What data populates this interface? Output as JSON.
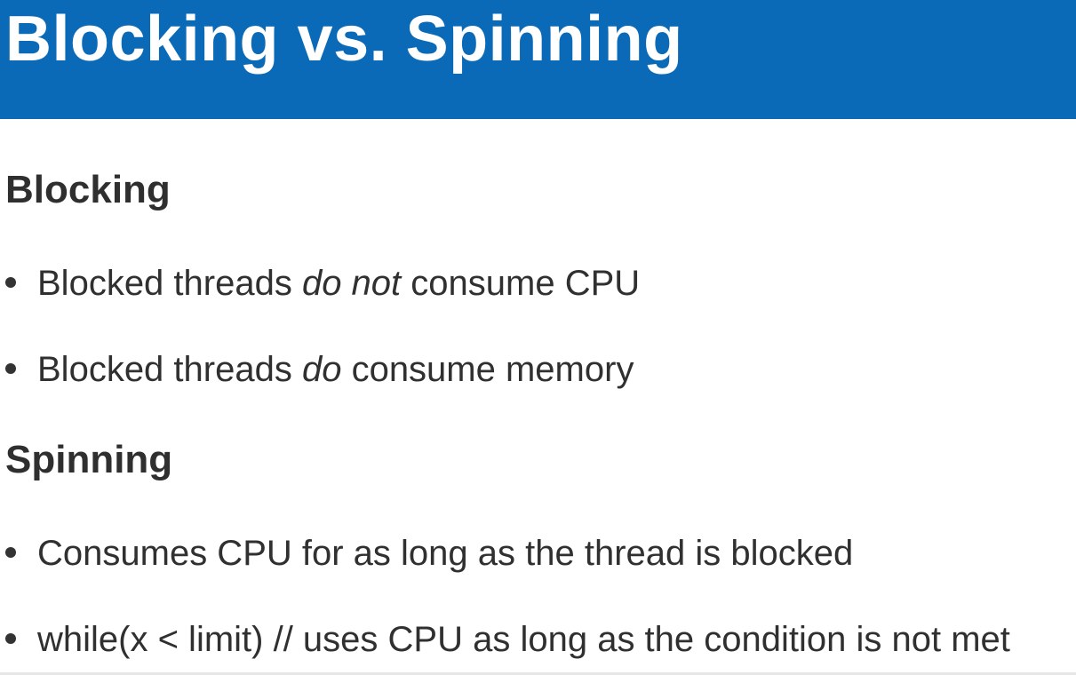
{
  "slide": {
    "title": "Blocking vs. Spinning",
    "colors": {
      "title_bar": "#0a6ab7",
      "title_text": "#ffffff",
      "body_text": "#303030"
    }
  },
  "sections": {
    "blocking": {
      "heading": "Blocking",
      "bullets": [
        {
          "before": "Blocked threads ",
          "emphasis": "do not",
          "after": " consume CPU"
        },
        {
          "before": "Blocked threads ",
          "emphasis": "do",
          "after": " consume memory"
        }
      ]
    },
    "spinning": {
      "heading": "Spinning",
      "bullets": [
        {
          "text": "Consumes CPU for as long as the thread is blocked"
        },
        {
          "text": "while(x < limit) // uses CPU as long as the condition is not met"
        }
      ]
    }
  }
}
